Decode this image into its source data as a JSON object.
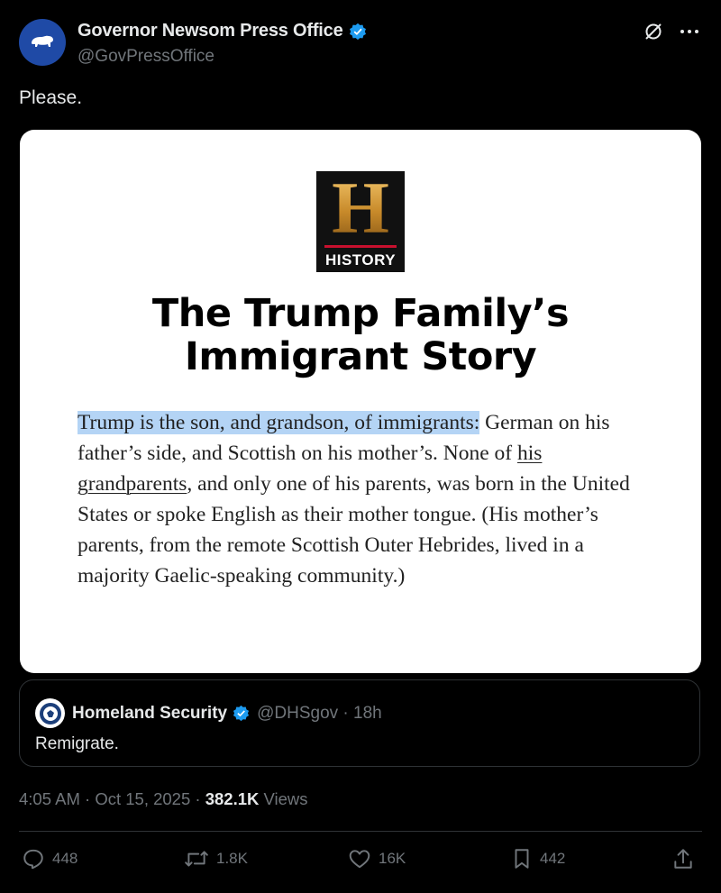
{
  "author": {
    "name": "Governor Newsom Press Office",
    "handle": "@GovPressOffice",
    "verified": true
  },
  "post": {
    "text": "Please."
  },
  "media": {
    "logo_text": "HISTORY",
    "logo_letter": "H",
    "headline_line1": "The Trump Family’s",
    "headline_line2": "Immigrant Story",
    "article_highlighted": "Trump is the son, and grandson, of immigrants:",
    "article_part1": " German on his father’s side, and Scottish on his mother’s. None of ",
    "article_link": "his grandparents",
    "article_part2": ", and only one of his parents, was born in the United States or spoke English as their mother tongue. (His mother’s parents, from the remote Scottish Outer Hebrides, lived in a majority Gaelic-speaking community.)"
  },
  "quoted": {
    "name": "Homeland Security",
    "handle_time": "@DHSgov · 18h",
    "text": "Remigrate."
  },
  "meta": {
    "time": "4:05 AM · Oct 15, 2025 · ",
    "views_count": "382.1K",
    "views_label": " Views"
  },
  "actions": {
    "replies": "448",
    "reposts": "1.8K",
    "likes": "16K",
    "bookmarks": "442"
  },
  "colors": {
    "background": "#000000",
    "muted": "#71767b",
    "verified": "#1d9bf0",
    "highlight": "#b4d4f5"
  },
  "icons": [
    "grok-icon",
    "more-icon",
    "verified-badge-icon",
    "reply-icon",
    "repost-icon",
    "like-icon",
    "bookmark-icon",
    "share-icon"
  ]
}
